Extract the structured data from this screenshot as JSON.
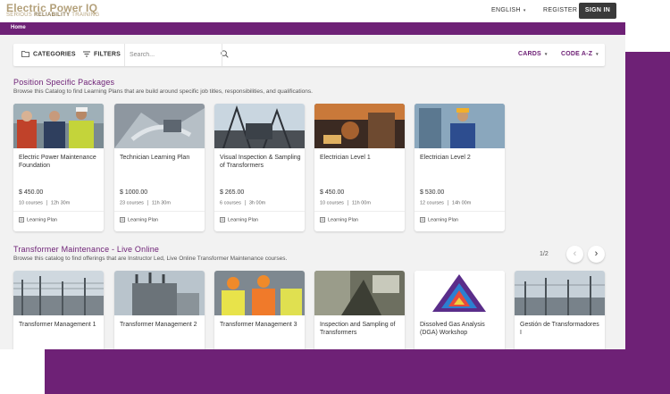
{
  "header": {
    "brand_title": "Electric Power IQ",
    "brand_sub_a": "SERIOUS ",
    "brand_sub_b": "RELIABILITY",
    "brand_sub_c": " TRAINING",
    "language": "ENGLISH",
    "register": "REGISTER",
    "sign_in": "SIGN IN"
  },
  "nav": {
    "home": "Home"
  },
  "toolbar": {
    "categories": "CATEGORIES",
    "filters": "FILTERS",
    "search_placeholder": "Search...",
    "view": "CARDS",
    "sort": "CODE A-Z"
  },
  "sections": [
    {
      "title": "Position Specific Packages",
      "description": "Browse this Catalog to find Learning Plans that are build around specific job titles, responsibilities, and qualifications.",
      "cards": [
        {
          "title": "Electric Power Maintenance Foundation",
          "price": "$ 450.00",
          "courses": "10 courses",
          "duration": "12h 30m",
          "type": "Learning Plan"
        },
        {
          "title": "Technician Learning Plan",
          "price": "$ 1000.00",
          "courses": "23 courses",
          "duration": "11h 30m",
          "type": "Learning Plan"
        },
        {
          "title": "Visual Inspection & Sampling of Transformers",
          "price": "$ 265.00",
          "courses": "6 courses",
          "duration": "3h 00m",
          "type": "Learning Plan"
        },
        {
          "title": "Electrician Level 1",
          "price": "$ 450.00",
          "courses": "10 courses",
          "duration": "11h 00m",
          "type": "Learning Plan"
        },
        {
          "title": "Electrician Level 2",
          "price": "$ 530.00",
          "courses": "12 courses",
          "duration": "14h 00m",
          "type": "Learning Plan"
        }
      ]
    },
    {
      "title": "Transformer Maintenance - Live Online",
      "description": "Browse this catalog to find offerings that are Instructor Led, Live Online Transformer Maintenance courses.",
      "pager": "1/2",
      "cards": [
        {
          "title": "Transformer Management 1"
        },
        {
          "title": "Transformer Management 2"
        },
        {
          "title": "Transformer Management 3"
        },
        {
          "title": "Inspection and Sampling of Transformers"
        },
        {
          "title": "Dissolved Gas Analysis (DGA) Workshop"
        },
        {
          "title": "Gestión de Transformadores I"
        }
      ]
    }
  ],
  "colors": {
    "brand_purple": "#6e2176",
    "brand_gold": "#b3a07a",
    "signin_bg": "#3a3a3a"
  }
}
